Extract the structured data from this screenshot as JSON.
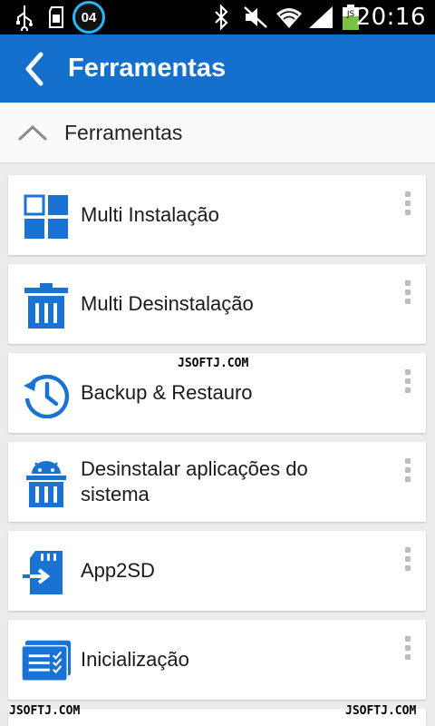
{
  "status_bar": {
    "time": "20:16",
    "notification_count": "04",
    "icons": [
      "usb-icon",
      "sd-card-icon",
      "download-notification-icon",
      "bluetooth-icon",
      "mute-icon",
      "wifi-icon",
      "signal-icon",
      "battery-icon"
    ]
  },
  "app_bar": {
    "title": "Ferramentas",
    "back_icon": "chevron-left-icon"
  },
  "section": {
    "title": "Ferramentas",
    "collapse_icon": "chevron-up-icon"
  },
  "tools": [
    {
      "label": "Multi Instalação",
      "icon": "grid-icon"
    },
    {
      "label": "Multi Desinstalação",
      "icon": "trash-icon"
    },
    {
      "label": "Backup & Restauro",
      "icon": "history-icon"
    },
    {
      "label": "Desinstalar aplicações do sistema",
      "icon": "android-trash-icon"
    },
    {
      "label": "App2SD",
      "icon": "sd-card-move-icon"
    },
    {
      "label": "Inicialização",
      "icon": "startup-list-icon"
    }
  ],
  "watermarks": {
    "center": "JSOFTJ.COM",
    "bottom_left": "JSOFTJ.COM",
    "bottom_right": "JSOFTJ.COM"
  },
  "colors": {
    "app_bar": "#1570cd",
    "icon_blue": "#1a73d4",
    "background": "#ececec",
    "card": "#ffffff"
  }
}
